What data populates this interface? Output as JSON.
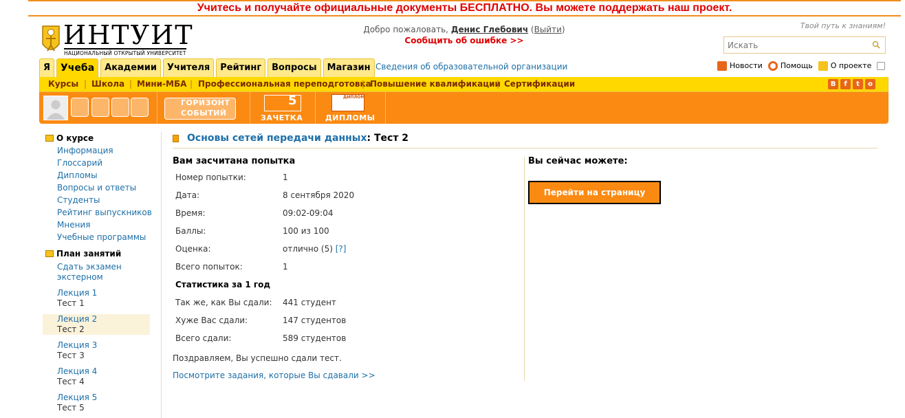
{
  "banner": "Учитесь и получайте официальные документы БЕСПЛАТНО. Вы можете поддержать наш проект.",
  "logo": {
    "word": "ИНТУИТ",
    "sub": "НАЦИОНАЛЬНЫЙ ОТКРЫТЫЙ УНИВЕРСИТЕТ"
  },
  "header": {
    "welcome_prefix": "Добро пожаловать,",
    "user": "Денис Глебович",
    "exit": "Выйти",
    "report": "Сообщить об ошибке >>",
    "slogan": "Твой путь к знаниям!",
    "search_placeholder": "Искать"
  },
  "tabs": [
    "Я",
    "Учеба",
    "Академии",
    "Учителя",
    "Рейтинг",
    "Вопросы",
    "Магазин"
  ],
  "active_tab": "Учеба",
  "info_link": "Сведения об образовательной организации",
  "right_links": [
    "Новости",
    "Помощь",
    "О проекте"
  ],
  "subnav": [
    "Курсы",
    "Школа",
    "Мини-МБА",
    "Профессиональная переподготовка",
    "Повышение квалификации",
    "Сертификации"
  ],
  "social": [
    "В",
    "f",
    "t",
    "о"
  ],
  "orange_bar": {
    "horizon": [
      "ГОРИЗОНТ",
      "СОБЫТИЙ"
    ],
    "zachetka": "ЗАЧЕТКА",
    "zachetka_num": "5",
    "diplomy": "ДИПЛОМЫ",
    "diplom_small": "ДИПЛОМ"
  },
  "sidebar": {
    "about_title": "О курсе",
    "about_items": [
      "Информация",
      "Глоссарий",
      "Дипломы",
      "Вопросы и ответы",
      "Студенты",
      "Рейтинг выпускников",
      "Мнения",
      "Учебные программы"
    ],
    "plan_title": "План занятий",
    "exam": [
      "Сдать экзамен",
      "экстерном"
    ],
    "lectures": [
      {
        "lecture": "Лекция 1",
        "test": "Тест 1"
      },
      {
        "lecture": "Лекция 2",
        "test": "Тест 2"
      },
      {
        "lecture": "Лекция 3",
        "test": "Тест 3"
      },
      {
        "lecture": "Лекция 4",
        "test": "Тест 4"
      },
      {
        "lecture": "Лекция 5",
        "test": "Тест 5"
      }
    ]
  },
  "main": {
    "course": "Основы сетей передачи данных",
    "test": ": Тест 2",
    "attempt_heading": "Вам засчитана попытка",
    "rows": [
      {
        "label": "Номер попытки:",
        "value": "1"
      },
      {
        "label": "Дата:",
        "value": "8 сентября 2020"
      },
      {
        "label": "Время:",
        "value": "09:02-09:04"
      },
      {
        "label": "Баллы:",
        "value": "100 из 100"
      },
      {
        "label": "Оценка:",
        "value": "отлично (5)",
        "help": "[?]"
      },
      {
        "label": "Всего попыток:",
        "value": "1"
      }
    ],
    "stats_heading": "Статистика за 1 год",
    "stats": [
      {
        "label": "Так же, как Вы сдали:",
        "value": "441 студент"
      },
      {
        "label": "Хуже Вас сдали:",
        "value": "147 студентов"
      },
      {
        "label": "Всего сдали:",
        "value": "589 студентов"
      }
    ],
    "congrats": "Поздравляем, Вы успешно сдали тест.",
    "see_tasks": "Посмотрите задания, которые Вы сдавали >>",
    "can_heading": "Вы сейчас можете:",
    "go_button": "Перейти на страницу курса"
  },
  "colors": {
    "orange": "#fb8a13",
    "yellow": "#ffd800",
    "link": "#1d6fa8",
    "red": "#e00000"
  }
}
